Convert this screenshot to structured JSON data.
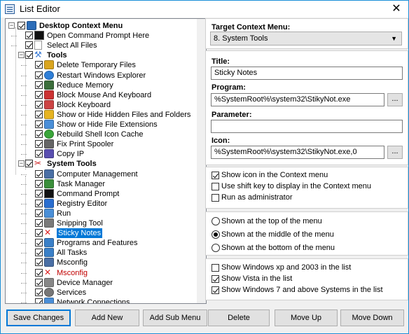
{
  "window": {
    "title": "List Editor",
    "close_glyph": "✕"
  },
  "tree": {
    "items": [
      {
        "label": "Desktop Context Menu",
        "level": 0,
        "bold": true,
        "icon": "monitor-icon",
        "expanded": true,
        "checked": true
      },
      {
        "label": "Open Command Prompt Here",
        "level": 1,
        "icon": "cmd-icon",
        "checked": true
      },
      {
        "label": "Select All Files",
        "level": 1,
        "icon": "file-icon",
        "checked": true
      },
      {
        "label": "Tools",
        "level": 1,
        "bold": true,
        "icon": "tools-icon",
        "expanded": true,
        "checked": true
      },
      {
        "label": "Delete Temporary Files",
        "level": 2,
        "icon": "broom-icon",
        "checked": true
      },
      {
        "label": "Restart Windows Explorer",
        "level": 2,
        "icon": "globe-icon",
        "checked": true
      },
      {
        "label": "Reduce Memory",
        "level": 2,
        "icon": "memory-icon",
        "checked": true
      },
      {
        "label": "Block Mouse And Keyboard",
        "level": 2,
        "icon": "block-icon",
        "checked": true
      },
      {
        "label": "Block Keyboard",
        "level": 2,
        "icon": "keyboard-block-icon",
        "checked": true
      },
      {
        "label": "Show or Hide Hidden Files and Folders",
        "level": 2,
        "icon": "folder-icon",
        "checked": true
      },
      {
        "label": "Show or Hide File Extensions",
        "level": 2,
        "icon": "extension-icon",
        "checked": true
      },
      {
        "label": "Rebuild Shell Icon Cache",
        "level": 2,
        "icon": "refresh-icon",
        "checked": true
      },
      {
        "label": "Fix Print Spooler",
        "level": 2,
        "icon": "printer-icon",
        "checked": true
      },
      {
        "label": "Copy IP",
        "level": 2,
        "icon": "ip-icon",
        "checked": true
      },
      {
        "label": "System Tools",
        "level": 1,
        "bold": true,
        "icon": "system-tools-icon",
        "expanded": true,
        "checked": true
      },
      {
        "label": "Computer Management",
        "level": 2,
        "icon": "computer-icon",
        "checked": true
      },
      {
        "label": "Task Manager",
        "level": 2,
        "icon": "task-manager-icon",
        "checked": true
      },
      {
        "label": "Command Prompt",
        "level": 2,
        "icon": "cmd-icon",
        "checked": true
      },
      {
        "label": "Registry Editor",
        "level": 2,
        "icon": "registry-icon",
        "checked": true
      },
      {
        "label": "Run",
        "level": 2,
        "icon": "run-icon",
        "checked": true
      },
      {
        "label": "Snipping Tool",
        "level": 2,
        "icon": "scissors-icon",
        "checked": true
      },
      {
        "label": "Sticky Notes",
        "level": 2,
        "icon": "red-x-icon",
        "checked": true,
        "selected": true
      },
      {
        "label": "Programs and Features",
        "level": 2,
        "icon": "programs-icon",
        "checked": true
      },
      {
        "label": "All Tasks",
        "level": 2,
        "icon": "all-tasks-icon",
        "checked": true
      },
      {
        "label": "Msconfig",
        "level": 2,
        "icon": "msconfig-icon",
        "checked": true
      },
      {
        "label": "Msconfig",
        "level": 2,
        "icon": "red-x-icon",
        "checked": true,
        "red": true
      },
      {
        "label": "Device Manager",
        "level": 2,
        "icon": "device-manager-icon",
        "checked": true
      },
      {
        "label": "Services",
        "level": 2,
        "icon": "gear-icon",
        "checked": true
      },
      {
        "label": "Network Connections",
        "level": 2,
        "icon": "network-icon",
        "checked": true
      }
    ]
  },
  "target": {
    "label": "Target Context Menu:",
    "selected": "8. System Tools"
  },
  "title_field": {
    "label": "Title:",
    "value": "Sticky Notes"
  },
  "program": {
    "label": "Program:",
    "value": "%SystemRoot%\\system32\\StikyNot.exe",
    "browse": "..."
  },
  "parameter": {
    "label": "Parameter:",
    "value": ""
  },
  "icon_field": {
    "label": "Icon:",
    "value": "%SystemRoot%\\system32\\StikyNot.exe,0",
    "browse": "..."
  },
  "options": [
    {
      "label": "Show icon in the Context menu",
      "checked": true
    },
    {
      "label": "Use shift key to display in the Context menu",
      "checked": false
    },
    {
      "label": "Run as administrator",
      "checked": false
    }
  ],
  "position": [
    {
      "label": "Shown at the top of the menu",
      "selected": false
    },
    {
      "label": "Shown at the middle of the menu",
      "selected": true
    },
    {
      "label": "Shown at the bottom of the menu",
      "selected": false
    }
  ],
  "systems": [
    {
      "label": "Show Windows xp  and 2003 in the list",
      "checked": false
    },
    {
      "label": "Show Vista in the list",
      "checked": true
    },
    {
      "label": "Show Windows 7 and above Systems in the list",
      "checked": true
    }
  ],
  "buttons": {
    "save": "Save Changes",
    "add_new": "Add New",
    "add_sub": "Add Sub Menu",
    "delete": "Delete",
    "move_up": "Move Up",
    "move_down": "Move Down"
  },
  "colors": {
    "accent": "#0078d7",
    "selected_bg": "#0078d7",
    "red_text": "#c00000"
  }
}
